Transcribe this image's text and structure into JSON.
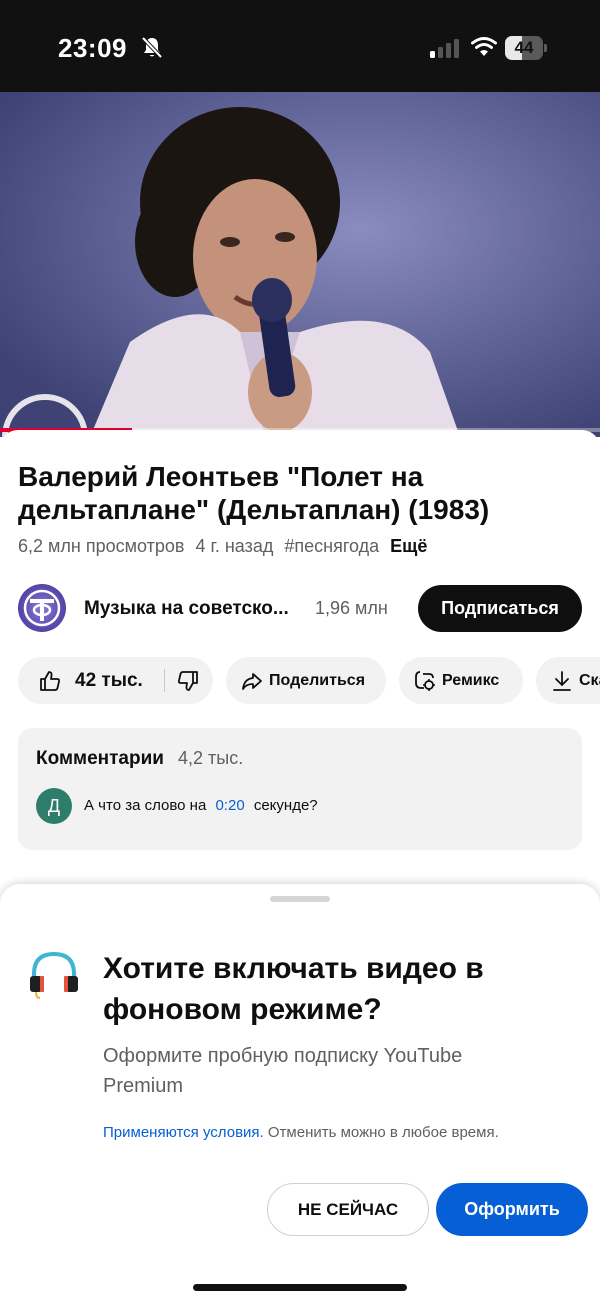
{
  "status_bar": {
    "time": "23:09",
    "battery": "44",
    "battery_level_percent": 44
  },
  "video": {
    "progress_percent": 22
  },
  "info": {
    "title": "Валерий Леонтьев \"Полет на дельтаплане\" (Дельтаплан) (1983)",
    "views": "6,2 млн просмотров",
    "age": "4 г. назад",
    "hashtag": "#песнягода",
    "more": "Ещё"
  },
  "channel": {
    "name": "Музыка на советско...",
    "subscribers": "1,96 млн",
    "subscribe_label": "Подписаться"
  },
  "actions": {
    "likes": "42 тыс.",
    "share": "Поделиться",
    "remix": "Ремикс",
    "download": "Скачать"
  },
  "comments": {
    "title": "Комментарии",
    "count": "4,2 тыс.",
    "avatar_letter": "Д",
    "text_before": "А что за слово на",
    "timestamp": "0:20",
    "text_after": "секунде?"
  },
  "promo": {
    "title": "Хотите включать видео в фоновом режиме?",
    "subtitle": "Оформите пробную подписку YouTube Premium",
    "terms_link": "Применяются условия.",
    "terms_rest": "Отменить можно в любое время.",
    "not_now": "НЕ СЕЙЧАС",
    "subscribe": "Оформить"
  },
  "colors": {
    "accent_blue": "#065fd4",
    "progress_red": "#e1002d",
    "comment_avatar": "#2e7d6a"
  }
}
